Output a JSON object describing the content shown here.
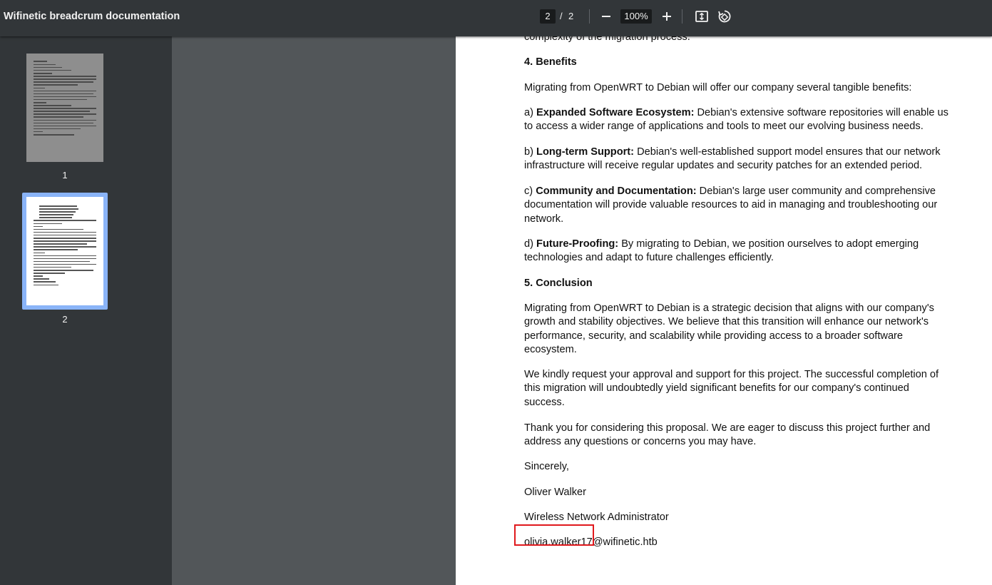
{
  "toolbar": {
    "title": "Wifinetic breadcrum documentation",
    "current_page": "2",
    "page_separator": "/",
    "total_pages": "2",
    "zoom": "100%"
  },
  "sidebar": {
    "thumbnails": [
      {
        "label": "1",
        "selected": false
      },
      {
        "label": "2",
        "selected": true
      }
    ]
  },
  "document": {
    "top_partial": "complexity of the migration process.",
    "benefits_heading": "4. Benefits",
    "benefits_intro": "Migrating from OpenWRT to Debian will offer our company several tangible benefits:",
    "benefits": [
      {
        "prefix": "a) ",
        "term": "Expanded Software Ecosystem:",
        "text": " Debian's extensive software repositories will enable us to access a wider range of applications and tools to meet our evolving business needs."
      },
      {
        "prefix": "b) ",
        "term": "Long-term Support:",
        "text": " Debian's well-established support model ensures that our network infrastructure will receive regular updates and security patches for an extended period."
      },
      {
        "prefix": "c) ",
        "term": "Community and Documentation:",
        "text": " Debian's large user community and comprehensive documentation will provide valuable resources to aid in managing and troubleshooting our network."
      },
      {
        "prefix": "d) ",
        "term": "Future-Proofing:",
        "text": " By migrating to Debian, we position ourselves to adopt emerging technologies and adapt to future challenges efficiently."
      }
    ],
    "conclusion_heading": "5. Conclusion",
    "conclusion_p1": "Migrating from OpenWRT to Debian is a strategic decision that aligns with our company's growth and stability objectives. We believe that this transition will enhance our network's performance, security, and scalability while providing access to a broader software ecosystem.",
    "conclusion_p2": "We kindly request your approval and support for this project. The successful completion of this migration will undoubtedly yield significant benefits for our company's continued success.",
    "conclusion_p3": "Thank you for considering this proposal. We are eager to discuss this project further and address any questions or concerns you may have.",
    "closing": "Sincerely,",
    "signer_name": "Oliver Walker",
    "signer_title": "Wireless Network Administrator",
    "email_user": "olivia.walker17",
    "email_domain": "@wifinetic.htb"
  },
  "colors": {
    "toolbar_bg": "#323639",
    "viewer_bg": "#525659",
    "selection_frame": "#8ab4f8",
    "annotation_box": "#e0191d"
  },
  "icons": [
    "zoom-out-icon",
    "zoom-in-icon",
    "fit-page-icon",
    "rotate-icon"
  ]
}
